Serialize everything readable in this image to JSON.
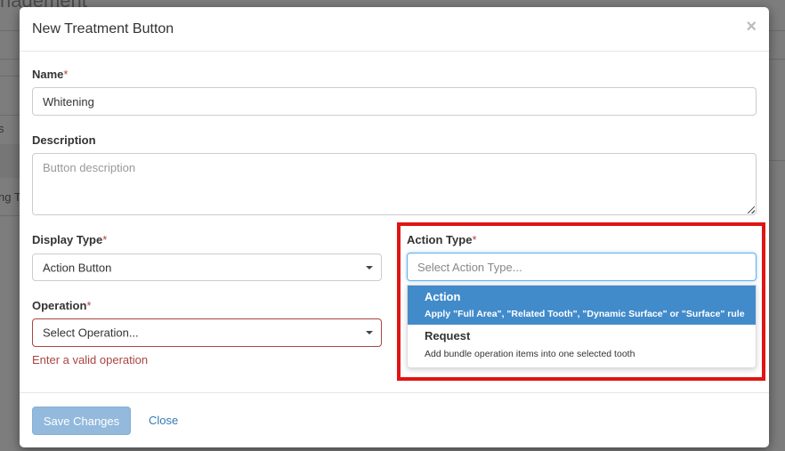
{
  "background": {
    "title_fragment": "nagement",
    "cell_fragment_1": "s",
    "cell_fragment_2": "ng T"
  },
  "modal": {
    "title": "New Treatment Button",
    "close_icon": "×"
  },
  "form": {
    "name": {
      "label": "Name",
      "required_mark": "*",
      "value": "Whitening"
    },
    "description": {
      "label": "Description",
      "placeholder": "Button description",
      "value": ""
    },
    "display_type": {
      "label": "Display Type",
      "required_mark": "*",
      "selected": "Action Button"
    },
    "operation": {
      "label": "Operation",
      "required_mark": "*",
      "placeholder": "Select Operation...",
      "error": "Enter a valid operation"
    },
    "action_type": {
      "label": "Action Type",
      "required_mark": "*",
      "search_placeholder": "Select Action Type...",
      "options": [
        {
          "title": "Action",
          "description": "Apply \"Full Area\", \"Related Tooth\", \"Dynamic Surface\" or \"Surface\" rule",
          "highlighted": true
        },
        {
          "title": "Request",
          "description": "Add bundle operation items into one selected tooth",
          "highlighted": false
        }
      ]
    }
  },
  "footer": {
    "save_label": "Save Changes",
    "close_label": "Close"
  },
  "colors": {
    "accent": "#428bca",
    "error": "#a94442",
    "highlight_box": "#e01414",
    "save_button_disabled": "#93b9dc",
    "link": "#337ab7"
  }
}
